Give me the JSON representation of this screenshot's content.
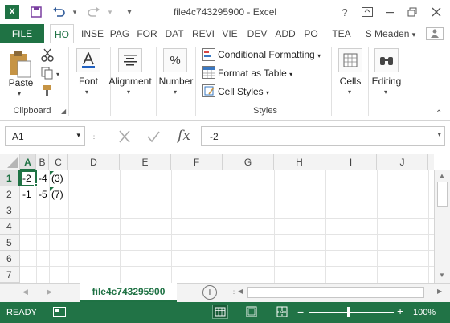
{
  "app": {
    "logo": "X",
    "title": "file4c743295900 - Excel",
    "help": "?",
    "user": "S Meaden"
  },
  "tabs": [
    "FILE",
    "HO",
    "INSE",
    "PAG",
    "FOR",
    "DAT",
    "REVI",
    "VIE",
    "DEV",
    "ADD",
    "PO",
    "TEA"
  ],
  "ribbon": {
    "clipboard": {
      "paste": "Paste",
      "group": "Clipboard"
    },
    "font": "Font",
    "alignment": "Alignment",
    "number": "Number",
    "number_icon": "%",
    "styles": {
      "conditional": "Conditional Formatting",
      "table": "Format as Table",
      "cell_styles": "Cell Styles",
      "group": "Styles"
    },
    "cells": "Cells",
    "editing": "Editing"
  },
  "formula": {
    "namebox": "A1",
    "fx": "fx",
    "value": "-2"
  },
  "grid": {
    "columns": [
      "A",
      "B",
      "C",
      "D",
      "E",
      "F",
      "G",
      "H",
      "I",
      "J"
    ],
    "rows": [
      "1",
      "2",
      "3",
      "4",
      "5",
      "6",
      "7"
    ],
    "cells": {
      "A1": "-2",
      "B1": "-4",
      "C1": "(3)",
      "A2": "-1",
      "B2": "-5",
      "C2": "(7)"
    }
  },
  "sheet": {
    "name": "file4c743295900"
  },
  "status": {
    "ready": "READY",
    "zoom": "100%",
    "minus": "−",
    "plus": "+"
  },
  "colors": {
    "accent": "#1f7244",
    "status": "#217346"
  }
}
